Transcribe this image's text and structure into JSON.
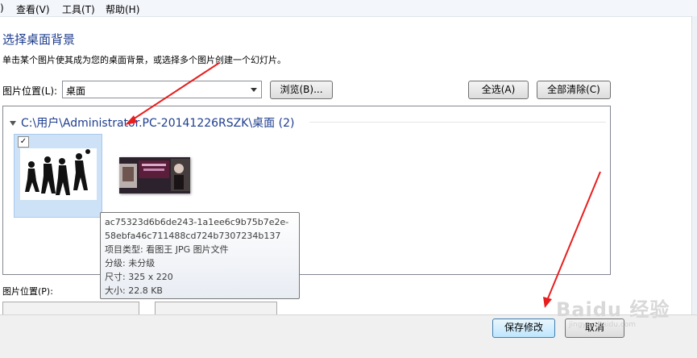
{
  "menubar": {
    "items": [
      ")",
      "查看(V)",
      "工具(T)",
      "帮助(H)"
    ]
  },
  "page": {
    "title": "选择桌面背景",
    "description": "单击某个图片使其成为您的桌面背景，或选择多个图片创建一个幻灯片。"
  },
  "location": {
    "label": "图片位置(L):",
    "value": "桌面"
  },
  "buttons": {
    "browse": "浏览(B)...",
    "select_all": "全选(A)",
    "clear_all": "全部清除(C)",
    "save": "保存修改",
    "cancel": "取消"
  },
  "gallery": {
    "group_header": "C:\\用户\\Administrator.PC-20141226RSZK\\桌面 (2)",
    "thumb1_checked": "✓"
  },
  "tooltip": {
    "line1": "ac75323d6b6de243-1a1ee6c9b75b7e2e-",
    "line2": "58ebfa46c711488cd724b7307234b137",
    "line3": "项目类型: 看图王 JPG 图片文件",
    "line4": "分级: 未分级",
    "line5": "尺寸: 325 x 220",
    "line6": "大小: 22.8 KB"
  },
  "position": {
    "label": "图片位置(P):"
  },
  "watermark": {
    "text": "Baidu 经验",
    "sub": "jingyan.baidu.com"
  },
  "colors": {
    "title": "#1e3d8f",
    "annotation_arrow": "#e81e1e",
    "selection": "#cde2f7"
  }
}
